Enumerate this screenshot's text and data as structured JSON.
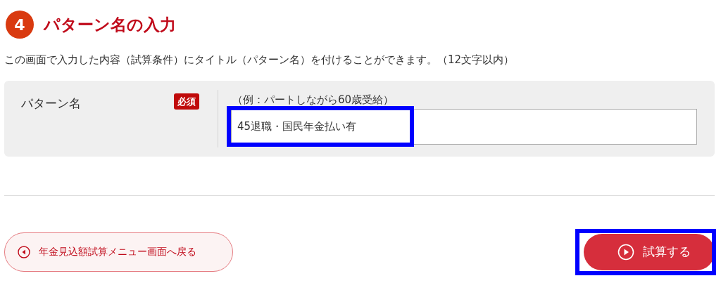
{
  "section": {
    "number": "4",
    "title": "パターン名の入力"
  },
  "description": "この画面で入力した内容（試算条件）にタイトル（パターン名）を付けることができます。（12文字以内）",
  "form": {
    "label": "パターン名",
    "required_badge": "必須",
    "example": "（例：パートしながら60歳受給）",
    "value": "45退職・国民年金払い有",
    "highlighted": true
  },
  "buttons": [
    {
      "kind": "back",
      "label": "年金見込額試算メニュー画面へ戻る",
      "highlighted": false
    },
    {
      "kind": "submit",
      "label": "試算する",
      "highlighted": true
    }
  ]
}
